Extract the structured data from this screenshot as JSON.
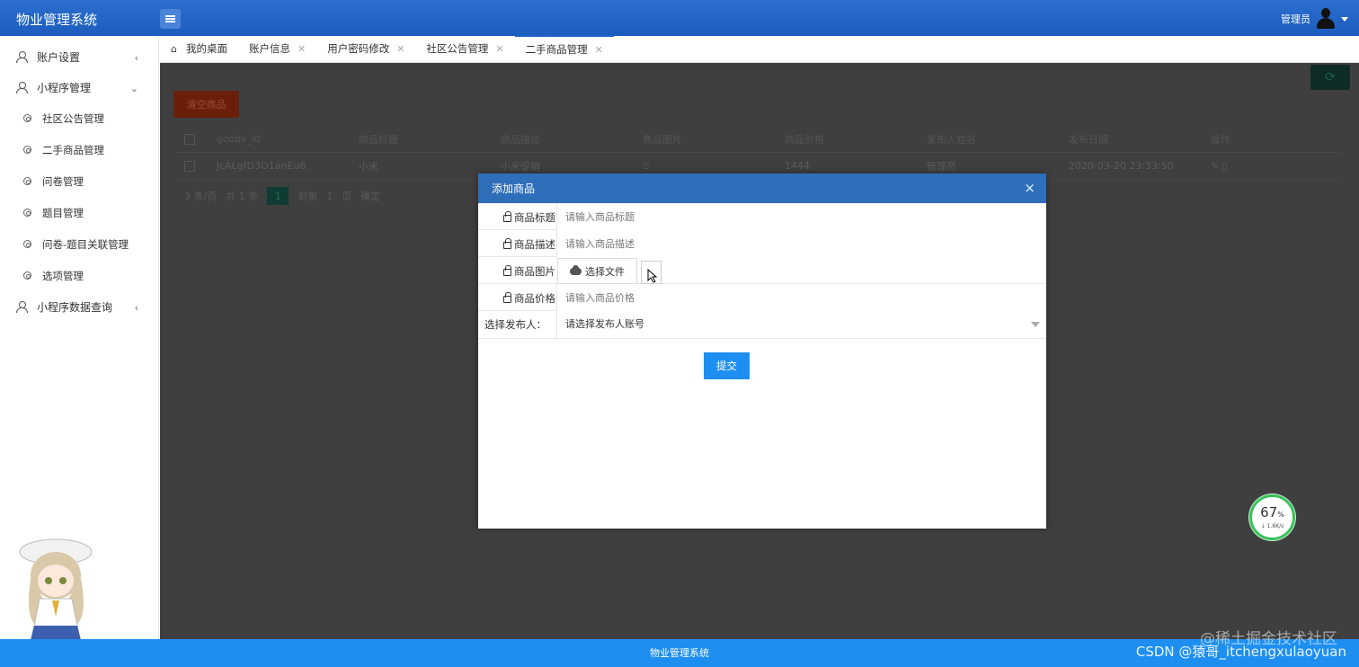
{
  "header": {
    "app_title": "物业管理系统",
    "user_name": "管理员"
  },
  "sidebar": {
    "items": [
      {
        "label": "账户设置",
        "icon": "user-icon",
        "chevron": "‹"
      },
      {
        "label": "小程序管理",
        "icon": "user-icon",
        "chevron": "⌄",
        "children": [
          "社区公告管理",
          "二手商品管理",
          "问卷管理",
          "题目管理",
          "问卷-题目关联管理",
          "选项管理"
        ]
      },
      {
        "label": "小程序数据查询",
        "icon": "user-icon",
        "chevron": "‹"
      }
    ]
  },
  "tabs": [
    {
      "label": "我的桌面",
      "closable": false
    },
    {
      "label": "账户信息",
      "closable": true
    },
    {
      "label": "用户密码修改",
      "closable": true
    },
    {
      "label": "社区公告管理",
      "closable": true
    },
    {
      "label": "二手商品管理",
      "closable": true,
      "active": true
    }
  ],
  "toolbar": {
    "delete_label": "清空商品"
  },
  "table": {
    "columns": [
      "goods_id",
      "商品标题",
      "商品描述",
      "商品图片",
      "商品价格",
      "发布人姓名",
      "发布日期",
      "操作"
    ],
    "rows": [
      [
        "JcALgfD3O1anEu8.",
        "小米",
        "小米促销",
        "",
        "1444",
        "管理员",
        "2020-03-20 23:33:50",
        ""
      ]
    ]
  },
  "pager": {
    "page_size": "3 条/页",
    "total": "共 1 条",
    "current": "1",
    "goto_label": "到第",
    "goto_value": "1",
    "page_unit": "页",
    "confirm": "确定"
  },
  "modal": {
    "title": "添加商品",
    "close": "×",
    "fields": {
      "title_label": "商品标题",
      "title_placeholder": "请输入商品标题",
      "desc_label": "商品描述",
      "desc_placeholder": "请输入商品描述",
      "image_label": "商品图片",
      "file_button": "选择文件",
      "price_label": "商品价格",
      "price_placeholder": "请输入商品价格",
      "publisher_label": "选择发布人：",
      "publisher_placeholder": "请选择发布人账号"
    },
    "submit": "提交"
  },
  "gauge": {
    "value": "67",
    "unit": "%",
    "speed": "↓ 1.8K/s"
  },
  "footer": {
    "text": "物业管理系统"
  },
  "watermarks": {
    "line1": "@稀土掘金技术社区",
    "line2": "CSDN @猿哥_itchengxulaoyuan"
  },
  "colors": {
    "header": "#1e63c8",
    "footer": "#1e8ff0",
    "submit": "#1e8ff0",
    "modal_head": "#2f6fb9"
  }
}
